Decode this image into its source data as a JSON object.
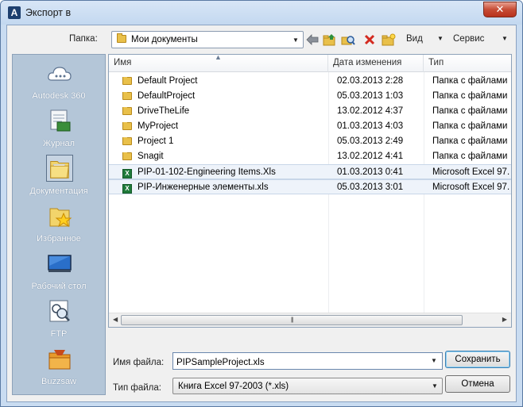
{
  "window": {
    "title": "Экспорт в",
    "app_icon_letter": "A",
    "close_label": "✕"
  },
  "toolbar": {
    "look_in_label": "Папка:",
    "look_in_value": "Мои документы",
    "view_label": "Вид",
    "tools_label": "Сервис"
  },
  "places": [
    {
      "label": "Autodesk 360",
      "icon": "cloud-icon"
    },
    {
      "label": "Журнал",
      "icon": "history-icon"
    },
    {
      "label": "Документация",
      "icon": "documents-folder-icon"
    },
    {
      "label": "Избранное",
      "icon": "favorites-icon"
    },
    {
      "label": "Рабочий стол",
      "icon": "desktop-icon"
    },
    {
      "label": "FTP",
      "icon": "ftp-icon"
    },
    {
      "label": "Buzzsaw",
      "icon": "buzzsaw-icon"
    }
  ],
  "file_list": {
    "columns": [
      "Имя",
      "Дата изменения",
      "Тип"
    ],
    "rows": [
      {
        "name": "Default Project",
        "date": "02.03.2013 2:28",
        "type": "Папка с файлами",
        "kind": "folder"
      },
      {
        "name": "DefaultProject",
        "date": "05.03.2013 1:03",
        "type": "Папка с файлами",
        "kind": "folder"
      },
      {
        "name": "DriveTheLife",
        "date": "13.02.2012 4:37",
        "type": "Папка с файлами",
        "kind": "folder"
      },
      {
        "name": "MyProject",
        "date": "01.03.2013 4:03",
        "type": "Папка с файлами",
        "kind": "folder"
      },
      {
        "name": "Project 1",
        "date": "05.03.2013 2:49",
        "type": "Папка с файлами",
        "kind": "folder"
      },
      {
        "name": "Snagit",
        "date": "13.02.2012 4:41",
        "type": "Папка с файлами",
        "kind": "folder"
      },
      {
        "name": "PIP-01-102-Engineering Items.Xls",
        "date": "01.03.2013 0:41",
        "type": "Microsoft Excel 97...",
        "kind": "xls"
      },
      {
        "name": "PIP-Инженерные элементы.xls",
        "date": "05.03.2013 3:01",
        "type": "Microsoft Excel 97...",
        "kind": "xls"
      }
    ]
  },
  "form": {
    "file_name_label": "Имя файла:",
    "file_name_value": "PIPSampleProject.xls",
    "file_type_label": "Тип файла:",
    "file_type_value": "Книга Excel 97-2003 (*.xls)",
    "save_label": "Сохранить",
    "cancel_label": "Отмена"
  }
}
